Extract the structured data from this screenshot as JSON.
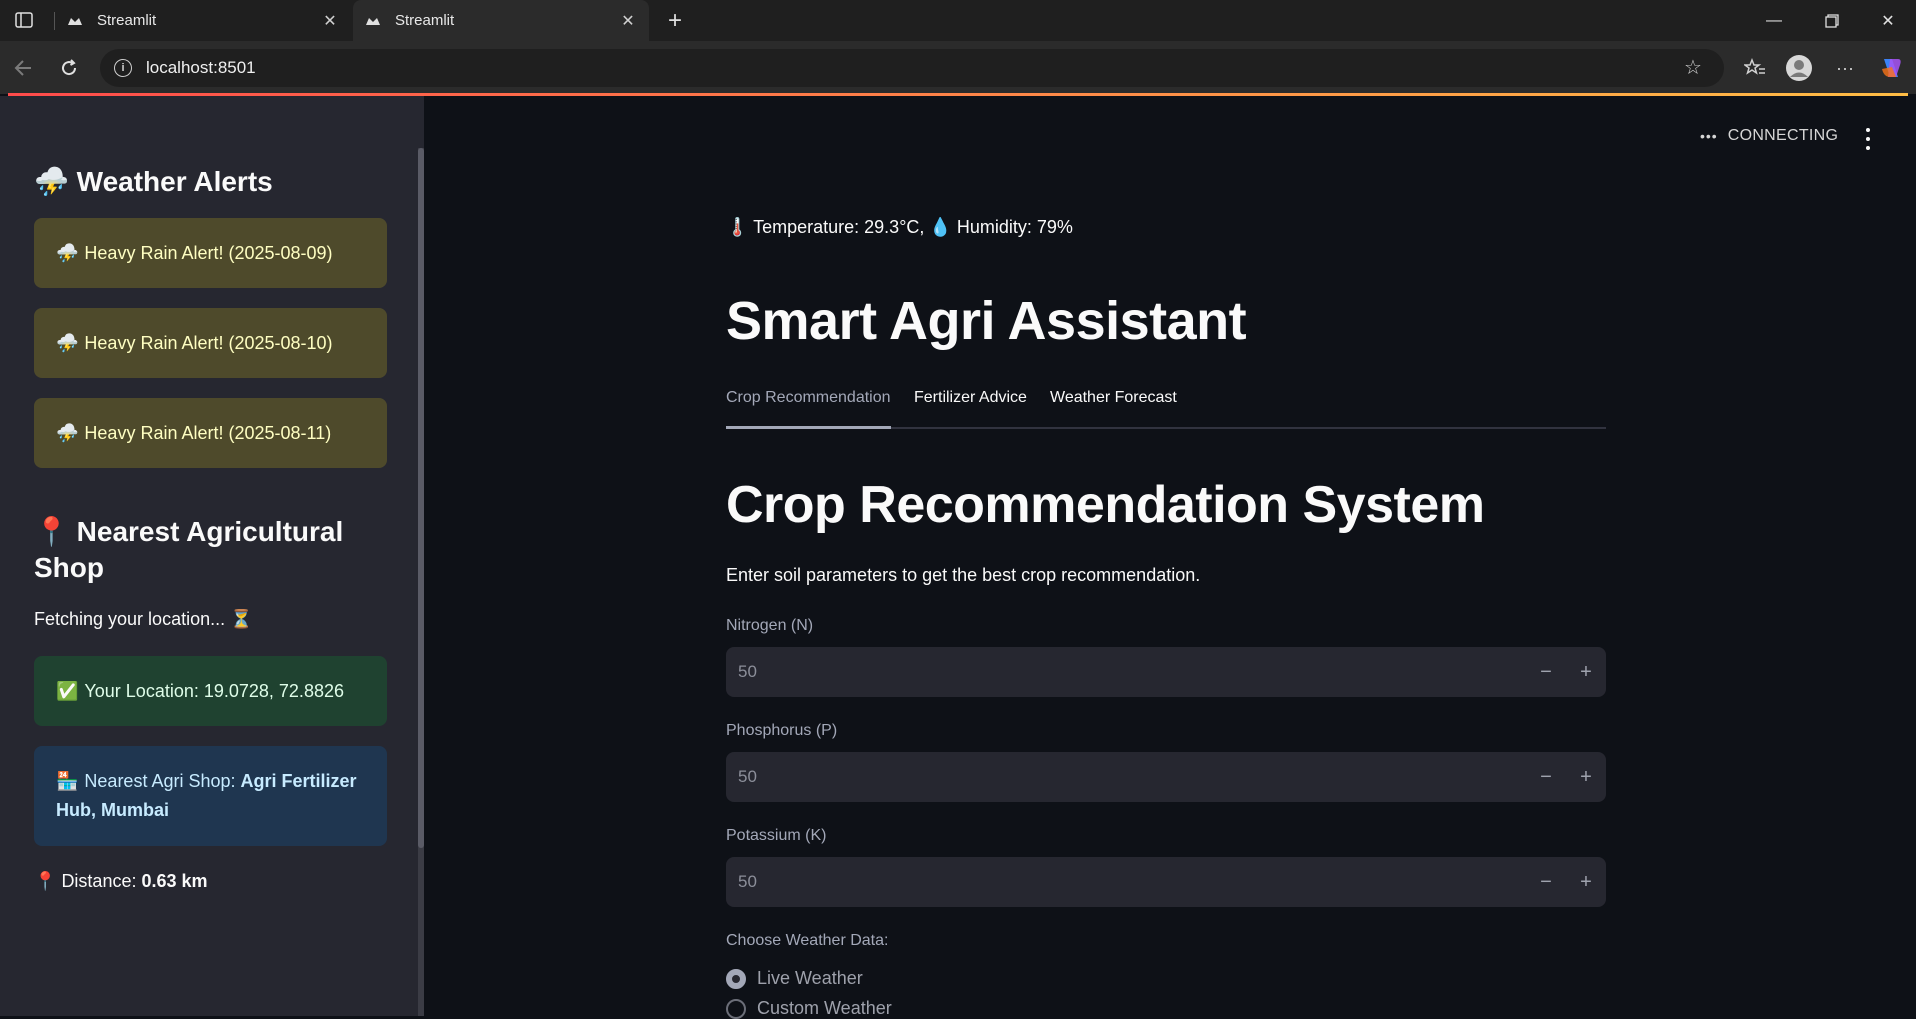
{
  "browser": {
    "tabs": [
      {
        "title": "Streamlit"
      },
      {
        "title": "Streamlit"
      }
    ],
    "url": "localhost:8501"
  },
  "sidebar": {
    "weather_title": "Weather Alerts",
    "alerts": [
      {
        "text": "Heavy Rain Alert! (2025-08-09)"
      },
      {
        "text": "Heavy Rain Alert! (2025-08-10)"
      },
      {
        "text": "Heavy Rain Alert! (2025-08-11)"
      }
    ],
    "shop_title_line1": "Nearest Agricultural",
    "shop_title_line2": "Shop",
    "fetching": "Fetching your location... ⏳",
    "location": "Your Location: 19.0728, 72.8826",
    "shop_prefix": "Nearest Agri Shop: ",
    "shop_name": "Agri Fertilizer Hub, Mumbai",
    "distance_prefix": "Distance: ",
    "distance_value": "0.63 km"
  },
  "main": {
    "status": "CONNECTING",
    "weather_line_temp": "Temperature: 29.3°C,",
    "weather_line_hum": "Humidity: 79%",
    "app_title": "Smart Agri Assistant",
    "tabs": [
      {
        "label": "Crop Recommendation"
      },
      {
        "label": "Fertilizer Advice"
      },
      {
        "label": "Weather Forecast"
      }
    ],
    "section_title": "Crop Recommendation System",
    "description": "Enter soil parameters to get the best crop recommendation.",
    "inputs": [
      {
        "label": "Nitrogen (N)",
        "value": "50"
      },
      {
        "label": "Phosphorus (P)",
        "value": "50"
      },
      {
        "label": "Potassium (K)",
        "value": "50"
      }
    ],
    "weather_choice_label": "Choose Weather Data:",
    "weather_options": [
      {
        "label": "Live Weather",
        "selected": true
      },
      {
        "label": "Custom Weather",
        "selected": false
      }
    ]
  },
  "colors": {
    "accent_line_start": "#ff4b4b",
    "accent_line_end": "#ffbd45",
    "sidebar_bg": "#262730",
    "main_bg": "#0e1117",
    "warning_bg": "#4e4a2b",
    "success_bg": "#1f4230",
    "info_bg": "#1f3650"
  }
}
